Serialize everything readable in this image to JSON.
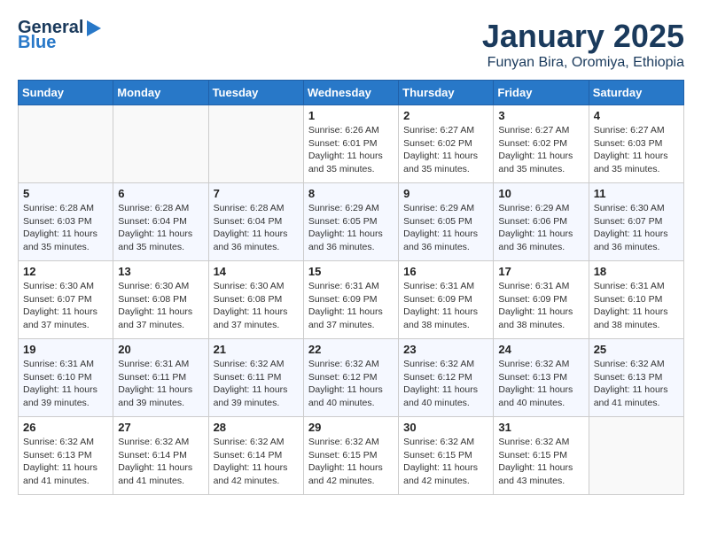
{
  "header": {
    "logo_general": "General",
    "logo_blue": "Blue",
    "month_title": "January 2025",
    "location": "Funyan Bira, Oromiya, Ethiopia"
  },
  "days_of_week": [
    "Sunday",
    "Monday",
    "Tuesday",
    "Wednesday",
    "Thursday",
    "Friday",
    "Saturday"
  ],
  "weeks": [
    [
      {
        "day": "",
        "info": ""
      },
      {
        "day": "",
        "info": ""
      },
      {
        "day": "",
        "info": ""
      },
      {
        "day": "1",
        "info": "Sunrise: 6:26 AM\nSunset: 6:01 PM\nDaylight: 11 hours and 35 minutes."
      },
      {
        "day": "2",
        "info": "Sunrise: 6:27 AM\nSunset: 6:02 PM\nDaylight: 11 hours and 35 minutes."
      },
      {
        "day": "3",
        "info": "Sunrise: 6:27 AM\nSunset: 6:02 PM\nDaylight: 11 hours and 35 minutes."
      },
      {
        "day": "4",
        "info": "Sunrise: 6:27 AM\nSunset: 6:03 PM\nDaylight: 11 hours and 35 minutes."
      }
    ],
    [
      {
        "day": "5",
        "info": "Sunrise: 6:28 AM\nSunset: 6:03 PM\nDaylight: 11 hours and 35 minutes."
      },
      {
        "day": "6",
        "info": "Sunrise: 6:28 AM\nSunset: 6:04 PM\nDaylight: 11 hours and 35 minutes."
      },
      {
        "day": "7",
        "info": "Sunrise: 6:28 AM\nSunset: 6:04 PM\nDaylight: 11 hours and 36 minutes."
      },
      {
        "day": "8",
        "info": "Sunrise: 6:29 AM\nSunset: 6:05 PM\nDaylight: 11 hours and 36 minutes."
      },
      {
        "day": "9",
        "info": "Sunrise: 6:29 AM\nSunset: 6:05 PM\nDaylight: 11 hours and 36 minutes."
      },
      {
        "day": "10",
        "info": "Sunrise: 6:29 AM\nSunset: 6:06 PM\nDaylight: 11 hours and 36 minutes."
      },
      {
        "day": "11",
        "info": "Sunrise: 6:30 AM\nSunset: 6:07 PM\nDaylight: 11 hours and 36 minutes."
      }
    ],
    [
      {
        "day": "12",
        "info": "Sunrise: 6:30 AM\nSunset: 6:07 PM\nDaylight: 11 hours and 37 minutes."
      },
      {
        "day": "13",
        "info": "Sunrise: 6:30 AM\nSunset: 6:08 PM\nDaylight: 11 hours and 37 minutes."
      },
      {
        "day": "14",
        "info": "Sunrise: 6:30 AM\nSunset: 6:08 PM\nDaylight: 11 hours and 37 minutes."
      },
      {
        "day": "15",
        "info": "Sunrise: 6:31 AM\nSunset: 6:09 PM\nDaylight: 11 hours and 37 minutes."
      },
      {
        "day": "16",
        "info": "Sunrise: 6:31 AM\nSunset: 6:09 PM\nDaylight: 11 hours and 38 minutes."
      },
      {
        "day": "17",
        "info": "Sunrise: 6:31 AM\nSunset: 6:09 PM\nDaylight: 11 hours and 38 minutes."
      },
      {
        "day": "18",
        "info": "Sunrise: 6:31 AM\nSunset: 6:10 PM\nDaylight: 11 hours and 38 minutes."
      }
    ],
    [
      {
        "day": "19",
        "info": "Sunrise: 6:31 AM\nSunset: 6:10 PM\nDaylight: 11 hours and 39 minutes."
      },
      {
        "day": "20",
        "info": "Sunrise: 6:31 AM\nSunset: 6:11 PM\nDaylight: 11 hours and 39 minutes."
      },
      {
        "day": "21",
        "info": "Sunrise: 6:32 AM\nSunset: 6:11 PM\nDaylight: 11 hours and 39 minutes."
      },
      {
        "day": "22",
        "info": "Sunrise: 6:32 AM\nSunset: 6:12 PM\nDaylight: 11 hours and 40 minutes."
      },
      {
        "day": "23",
        "info": "Sunrise: 6:32 AM\nSunset: 6:12 PM\nDaylight: 11 hours and 40 minutes."
      },
      {
        "day": "24",
        "info": "Sunrise: 6:32 AM\nSunset: 6:13 PM\nDaylight: 11 hours and 40 minutes."
      },
      {
        "day": "25",
        "info": "Sunrise: 6:32 AM\nSunset: 6:13 PM\nDaylight: 11 hours and 41 minutes."
      }
    ],
    [
      {
        "day": "26",
        "info": "Sunrise: 6:32 AM\nSunset: 6:13 PM\nDaylight: 11 hours and 41 minutes."
      },
      {
        "day": "27",
        "info": "Sunrise: 6:32 AM\nSunset: 6:14 PM\nDaylight: 11 hours and 41 minutes."
      },
      {
        "day": "28",
        "info": "Sunrise: 6:32 AM\nSunset: 6:14 PM\nDaylight: 11 hours and 42 minutes."
      },
      {
        "day": "29",
        "info": "Sunrise: 6:32 AM\nSunset: 6:15 PM\nDaylight: 11 hours and 42 minutes."
      },
      {
        "day": "30",
        "info": "Sunrise: 6:32 AM\nSunset: 6:15 PM\nDaylight: 11 hours and 42 minutes."
      },
      {
        "day": "31",
        "info": "Sunrise: 6:32 AM\nSunset: 6:15 PM\nDaylight: 11 hours and 43 minutes."
      },
      {
        "day": "",
        "info": ""
      }
    ]
  ]
}
